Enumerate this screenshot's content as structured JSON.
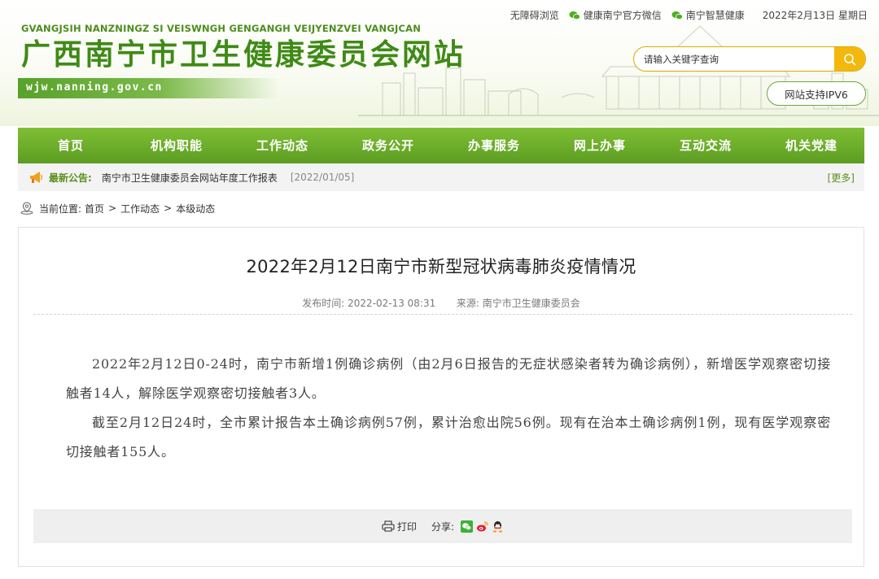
{
  "header": {
    "pinyin": "GVANGJSIH NANZNINGZ SI VEISWNGH GENGANGH VEIJYENZVEI VANGJCAN",
    "title": "广西南宁市卫生健康委员会网站",
    "url": "wjw.nanning.gov.cn",
    "top_links": {
      "accessibility": "无障碍浏览",
      "wechat_official": "健康南宁官方微信",
      "smart_health": "南宁智慧健康",
      "date": "2022年2月13日 星期日"
    },
    "search_placeholder": "请输入关键字查询",
    "ipv6": "网站支持IPV6"
  },
  "nav": {
    "items": [
      "首页",
      "机构职能",
      "工作动态",
      "政务公开",
      "办事服务",
      "网上办事",
      "互动交流",
      "机关党建"
    ]
  },
  "notice": {
    "label": "最新公告:",
    "text": "南宁市卫生健康委员会网站年度工作报表",
    "date": "[2022/01/05]",
    "more": "[更多]"
  },
  "breadcrumb": {
    "prefix": "当前位置:",
    "items": [
      "首页",
      "工作动态",
      "本级动态"
    ],
    "separator": ">"
  },
  "article": {
    "title": "2022年2月12日南宁市新型冠状病毒肺炎疫情情况",
    "publish_label": "发布时间:",
    "publish_time": "2022-02-13 08:31",
    "source_label": "来源:",
    "source": "南宁市卫生健康委员会",
    "paragraphs": [
      "2022年2月12日0-24时，南宁市新增1例确诊病例（由2月6日报告的无症状感染者转为确诊病例），新增医学观察密切接触者14人，解除医学观察密切接触者3人。",
      "截至2月12日24时，全市累计报告本土确诊病例57例，累计治愈出院56例。现有在治本土确诊病例1例，现有医学观察密切接触者155人。"
    ]
  },
  "tools": {
    "print": "打印",
    "share": "分享:",
    "share_targets": [
      "wechat-icon",
      "weibo-icon",
      "qq-icon"
    ]
  },
  "colors": {
    "brand_green": "#5c9d22",
    "search_accent": "#f2b80c",
    "notice_green": "#5b8f1d"
  }
}
